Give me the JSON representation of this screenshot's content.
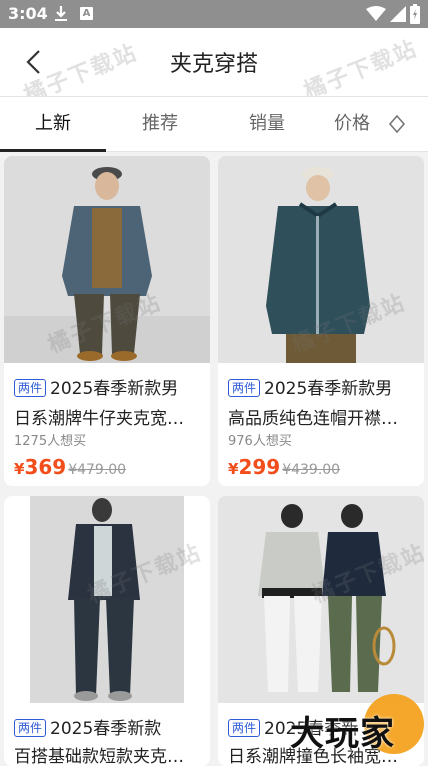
{
  "status_bar": {
    "time": "3:04",
    "a_glyph": "A"
  },
  "header": {
    "title": "夹克穿搭"
  },
  "watermark": "橘子下载站",
  "tabs": [
    {
      "label": "上新",
      "active": true
    },
    {
      "label": "推荐",
      "active": false
    },
    {
      "label": "销量",
      "active": false
    },
    {
      "label": "价格",
      "active": false
    }
  ],
  "products": [
    {
      "badge": "两件",
      "title_line1": "2025春季新款男",
      "title_line2": "日系潮牌牛仔夹克宽…",
      "want": "1275人想买",
      "currency": "¥",
      "price": "369",
      "original_price": "¥479.00"
    },
    {
      "badge": "两件",
      "title_line1": "2025春季新款男",
      "title_line2": "高品质纯色连帽开襟…",
      "want": "976人想买",
      "currency": "¥",
      "price": "299",
      "original_price": "¥439.00"
    },
    {
      "badge": "两件",
      "title_line1": "2025春季新款",
      "title_line2": "百搭基础款短款夹克…"
    },
    {
      "badge": "两件",
      "title_line1": "2025春季新",
      "title_line2": "日系潮牌撞色长袖宽…"
    }
  ],
  "logo_text": "大玩家",
  "colors": {
    "accent_price": "#f24d1a",
    "badge_blue": "#2f5bd6",
    "status_bar": "#8f8f8f"
  }
}
